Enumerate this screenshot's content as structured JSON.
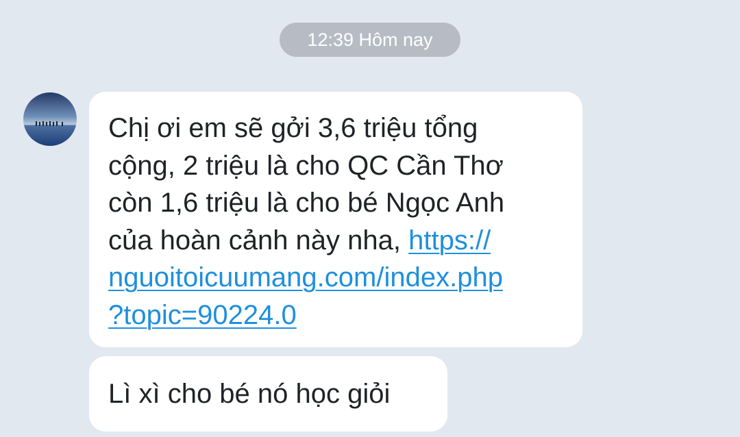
{
  "header": {
    "timestamp": "12:39 Hôm nay"
  },
  "messages": [
    {
      "avatar_icon": "avatar-photo-icon",
      "text_lines": [
        "Chị ơi em sẽ gởi 3,6 triệu tổng",
        "cộng, 2 triệu là cho QC Cần Thơ",
        "còn 1,6 triệu là cho bé Ngọc Anh",
        "của hoàn cảnh này nha, "
      ],
      "link_lines": [
        "https://",
        "nguoitoicuumang.com/index.php",
        "?topic=90224.0"
      ]
    },
    {
      "text": "Lì xì cho bé nó học giỏi"
    }
  ],
  "colors": {
    "background": "#e2e8f0",
    "bubble": "#ffffff",
    "link": "#1e8fde",
    "timestamp_pill": "#b7bcc4"
  }
}
